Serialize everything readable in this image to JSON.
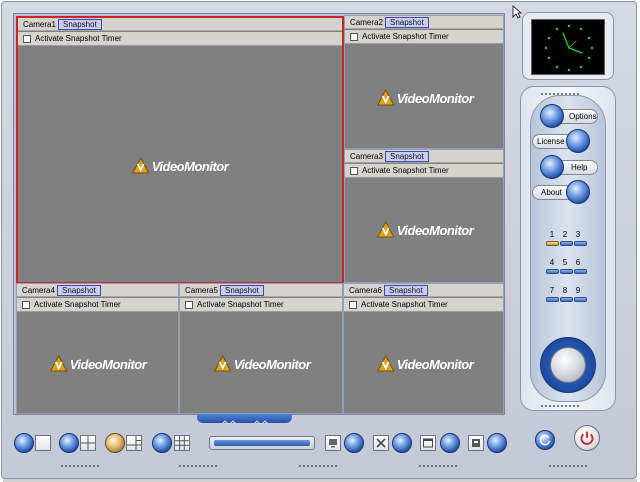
{
  "cameras": [
    {
      "name": "Camera1",
      "snapshot": "Snapshot",
      "timer_label": "Activate Snapshot Timer",
      "logo": "VideoMonitor"
    },
    {
      "name": "Camera2",
      "snapshot": "Snapshot",
      "timer_label": "Activate Snapshot Timer",
      "logo": "VideoMonitor"
    },
    {
      "name": "Camera3",
      "snapshot": "Snapshot",
      "timer_label": "Activate Snapshot Timer",
      "logo": "VideoMonitor"
    },
    {
      "name": "Camera4",
      "snapshot": "Snapshot",
      "timer_label": "Activate Snapshot Timer",
      "logo": "VideoMonitor"
    },
    {
      "name": "Camera5",
      "snapshot": "Snapshot",
      "timer_label": "Activate Snapshot Timer",
      "logo": "VideoMonitor"
    },
    {
      "name": "Camera6",
      "snapshot": "Snapshot",
      "timer_label": "Activate Snapshot Timer",
      "logo": "VideoMonitor"
    }
  ],
  "panel": {
    "options": "Options",
    "license": "License",
    "help": "Help",
    "about": "About",
    "numbers": [
      "1",
      "2",
      "3",
      "4",
      "5",
      "6",
      "7",
      "8",
      "9"
    ]
  },
  "colors": {
    "active_border": "#c8262b",
    "accent_blue": "#1f4fa8",
    "snapshot_bg": "#c8cdf2",
    "clock_green": "#19d24a"
  },
  "icons": [
    "clock-icon",
    "layout-single-icon",
    "layout-quad-icon",
    "layout-nine-icon",
    "monitor-icon",
    "tools-icon",
    "window-icon",
    "info-icon",
    "refresh-icon",
    "power-icon"
  ]
}
